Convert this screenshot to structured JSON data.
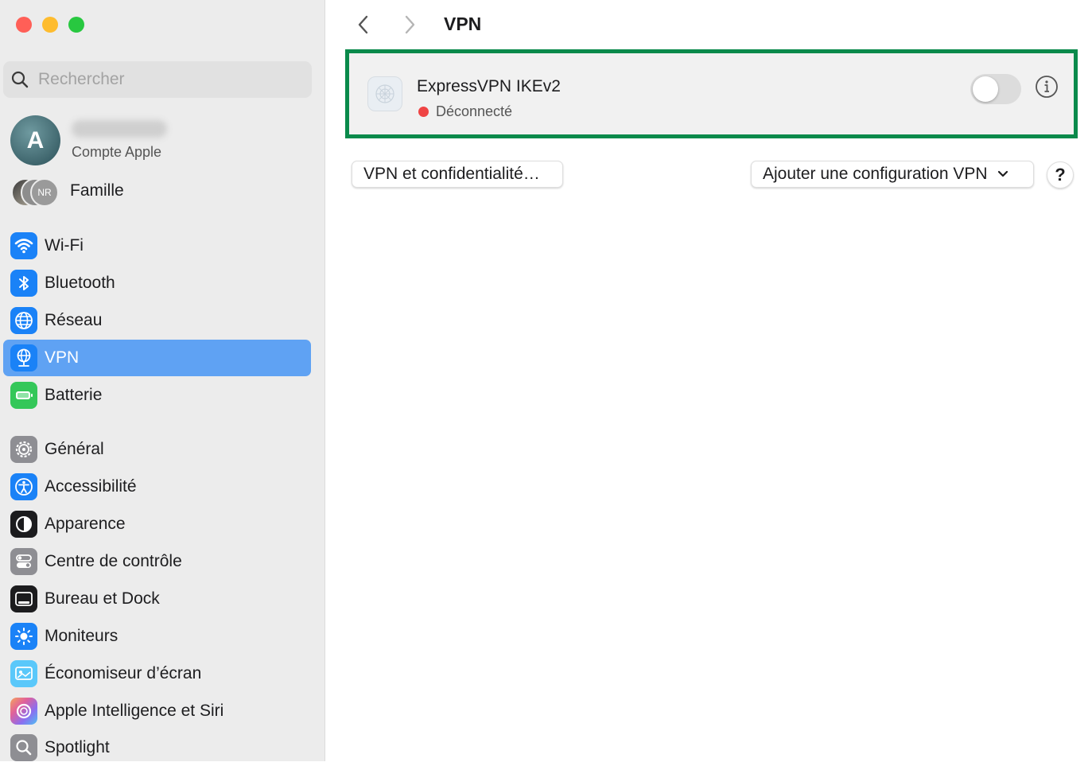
{
  "window": {
    "traffic_lights": {
      "close": "#ff5f57",
      "minimize": "#febc2e",
      "zoom": "#28c840"
    }
  },
  "sidebar": {
    "search": {
      "placeholder": "Rechercher",
      "value": ""
    },
    "account": {
      "avatar_letter": "A",
      "subtitle": "Compte Apple"
    },
    "family": {
      "badge": "NR",
      "label": "Famille"
    },
    "items": [
      {
        "label": "Wi-Fi",
        "icon": "wifi-icon",
        "color": "#1a82f7"
      },
      {
        "label": "Bluetooth",
        "icon": "bluetooth-icon",
        "color": "#1a82f7"
      },
      {
        "label": "Réseau",
        "icon": "globe-icon",
        "color": "#1a82f7"
      },
      {
        "label": "VPN",
        "icon": "vpn-globe-icon",
        "color": "#1a82f7",
        "selected": true
      },
      {
        "label": "Batterie",
        "icon": "battery-icon",
        "color": "#34c759"
      },
      {
        "label": "Général",
        "icon": "gear-icon",
        "color": "#8e8e93"
      },
      {
        "label": "Accessibilité",
        "icon": "accessibility-icon",
        "color": "#1a82f7"
      },
      {
        "label": "Apparence",
        "icon": "appearance-icon",
        "color": "#1c1c1e"
      },
      {
        "label": "Centre de contrôle",
        "icon": "control-center-icon",
        "color": "#8e8e93"
      },
      {
        "label": "Bureau et Dock",
        "icon": "dock-icon",
        "color": "#1c1c1e"
      },
      {
        "label": "Moniteurs",
        "icon": "sun-icon",
        "color": "#1a82f7"
      },
      {
        "label": "Économiseur d’écran",
        "icon": "screensaver-icon",
        "color": "#5ac8fa"
      },
      {
        "label": "Apple Intelligence et Siri",
        "icon": "siri-icon",
        "color": "#c86dd7"
      },
      {
        "label": "Spotlight",
        "icon": "spotlight-icon",
        "color": "#8e8e93"
      }
    ]
  },
  "main": {
    "title": "VPN",
    "vpn": {
      "name": "ExpressVPN IKEv2",
      "status": "Déconnecté",
      "status_color": "#ef4444",
      "enabled": false
    },
    "privacy_button": "VPN et confidentialité…",
    "add_config_button": "Ajouter une configuration VPN",
    "help_button": "?"
  },
  "highlight_color": "#0a8a4b",
  "accent_color": "#5fa2f3"
}
